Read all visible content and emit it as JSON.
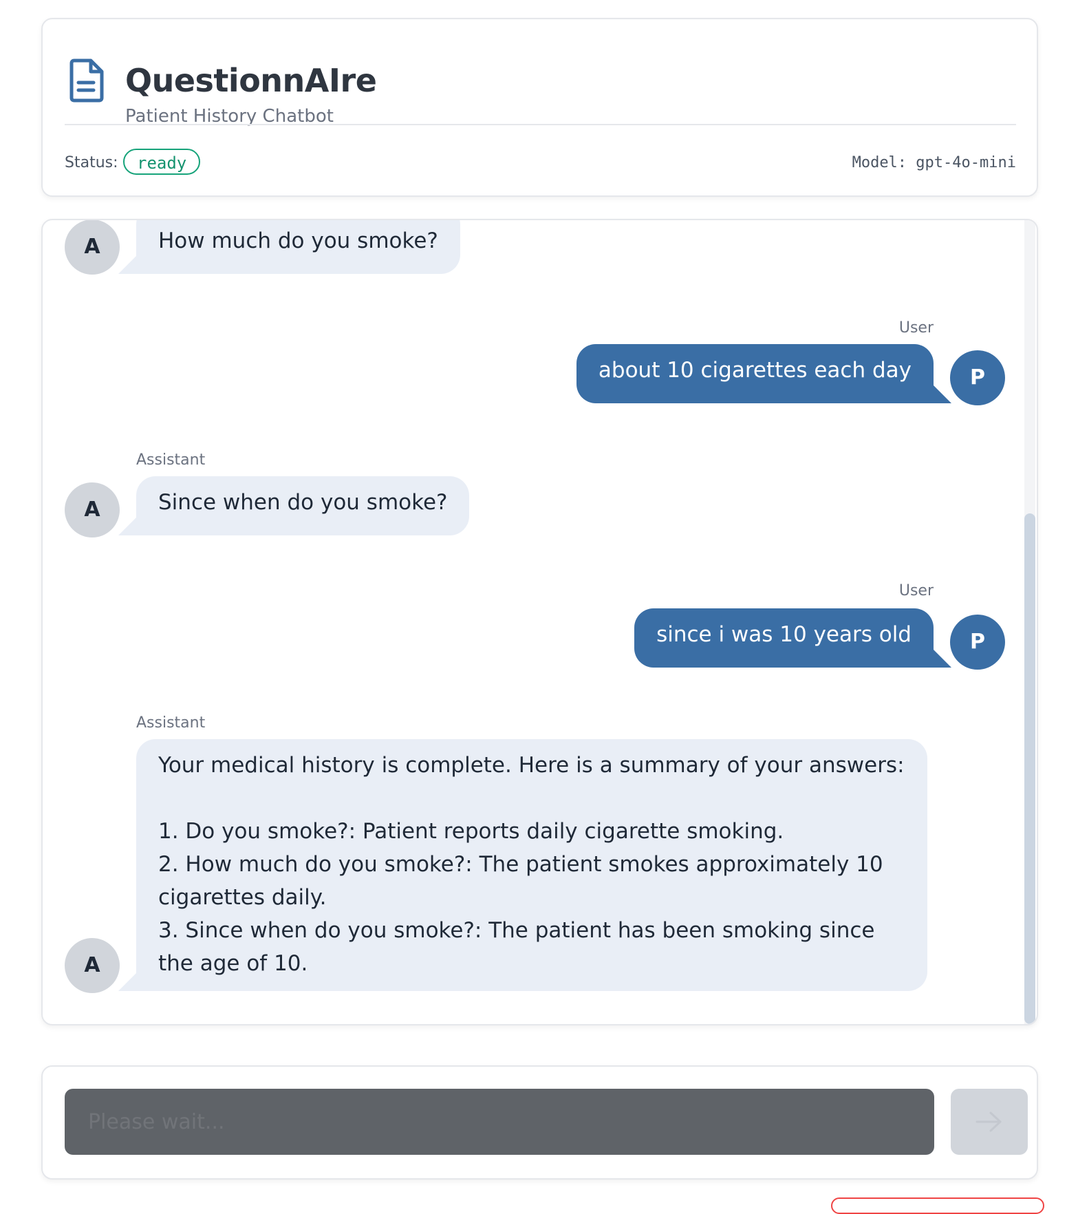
{
  "header": {
    "title": "QuestionnAIre",
    "subtitle": "Patient History Chatbot",
    "status_label": "Status:",
    "status_value": "ready",
    "model_text": "Model: gpt-4o-mini",
    "icon": "document-icon"
  },
  "chat": {
    "messages": [
      {
        "role": "assistant",
        "label": "",
        "avatar": "A",
        "text": "How much do you smoke?"
      },
      {
        "role": "user",
        "label": "User",
        "avatar": "P",
        "text": "about 10 cigarettes each day"
      },
      {
        "role": "assistant",
        "label": "Assistant",
        "avatar": "A",
        "text": "Since when do you smoke?"
      },
      {
        "role": "user",
        "label": "User",
        "avatar": "P",
        "text": "since i was 10 years old"
      },
      {
        "role": "assistant",
        "label": "Assistant",
        "avatar": "A",
        "text": "Your medical history is complete. Here is a summary of your answers:\n\n1. Do you smoke?: Patient reports daily cigarette smoking.\n2. How much do you smoke?: The patient smokes approximately 10 cigarettes daily.\n3. Since when do you smoke?: The patient has been smoking since the age of 10."
      }
    ]
  },
  "input": {
    "placeholder": "Please wait...",
    "send_icon": "arrow-right-icon"
  },
  "colors": {
    "accent": "#3a6ea5",
    "status_green": "#16a37a",
    "assistant_bubble": "#e9eef6"
  }
}
